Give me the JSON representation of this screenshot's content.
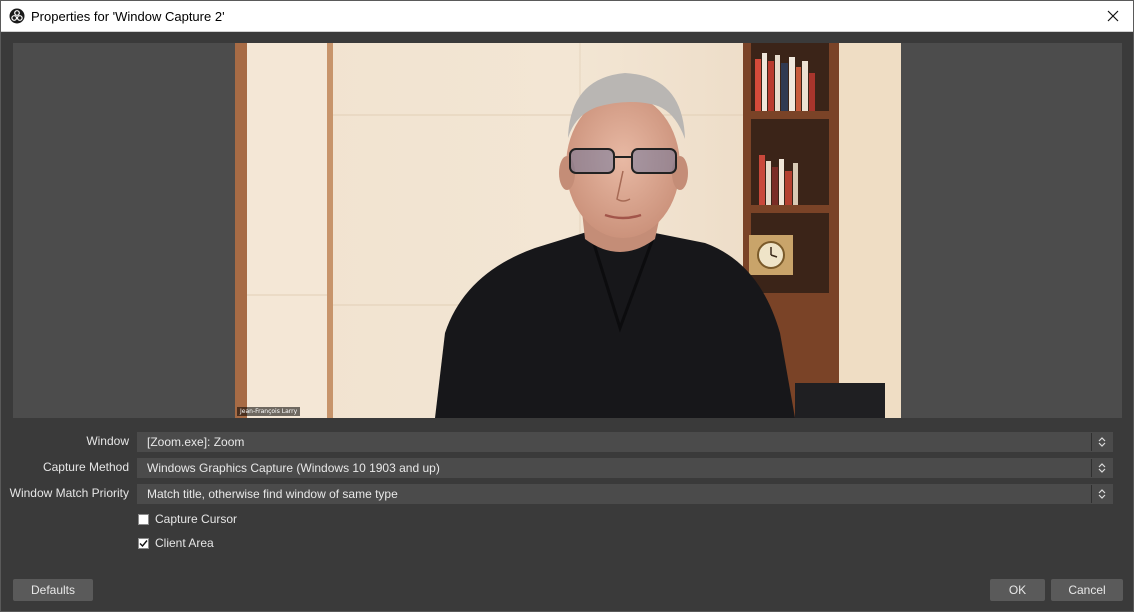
{
  "window": {
    "title": "Properties for 'Window Capture 2'",
    "logo_icon": "obs-logo-icon",
    "close_icon": "close-icon"
  },
  "preview": {
    "name_tag": "Jean-François Larry"
  },
  "properties": {
    "window": {
      "label": "Window",
      "value": "[Zoom.exe]: Zoom"
    },
    "capture_method": {
      "label": "Capture Method",
      "value": "Windows Graphics Capture (Windows 10 1903 and up)"
    },
    "match_priority": {
      "label": "Window Match Priority",
      "value": "Match title, otherwise find window of same type"
    },
    "capture_cursor": {
      "label": "Capture Cursor",
      "checked": false
    },
    "client_area": {
      "label": "Client Area",
      "checked": true
    }
  },
  "buttons": {
    "defaults": "Defaults",
    "ok": "OK",
    "cancel": "Cancel"
  },
  "colors": {
    "dialog_bg": "#3a3a3a",
    "preview_bg": "#4c4c4c",
    "combo_bg": "#4b4b4b",
    "button_bg": "#5a5a5a"
  }
}
